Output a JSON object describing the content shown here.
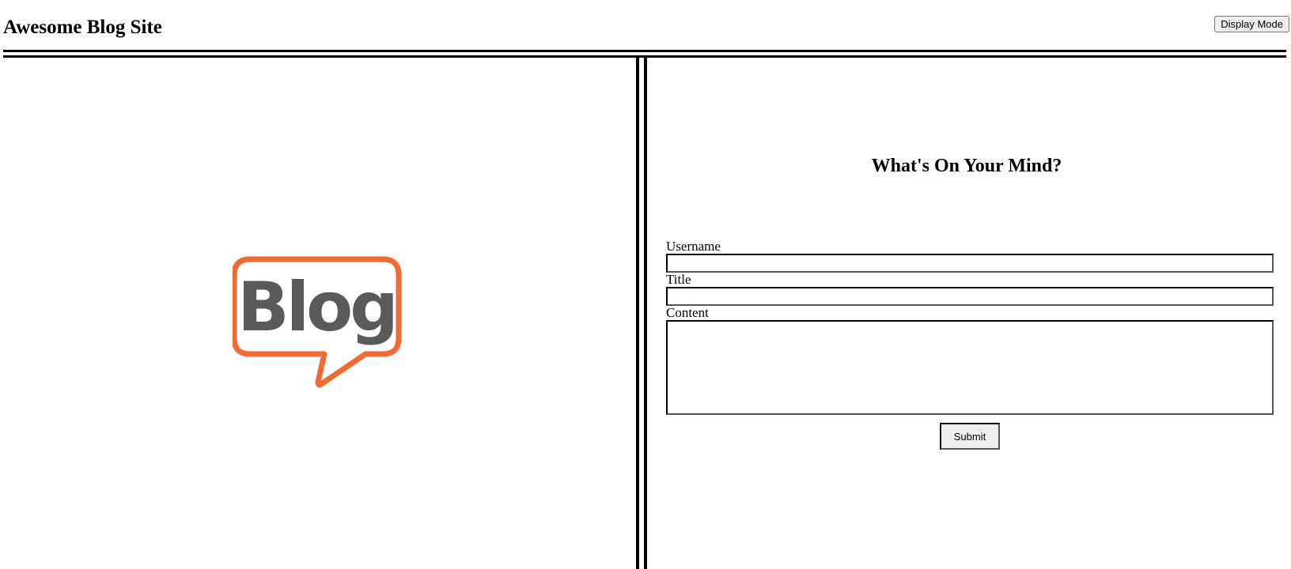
{
  "header": {
    "site_title": "Awesome Blog Site",
    "display_mode_label": "Display Mode"
  },
  "left": {
    "logo_text": "Blog",
    "logo_colors": {
      "bubble": "#f26a32",
      "text": "#5a5a5a"
    }
  },
  "form": {
    "heading": "What's On Your Mind?",
    "username_label": "Username",
    "username_value": "",
    "title_label": "Title",
    "title_value": "",
    "content_label": "Content",
    "content_value": "",
    "submit_label": "Submit"
  }
}
